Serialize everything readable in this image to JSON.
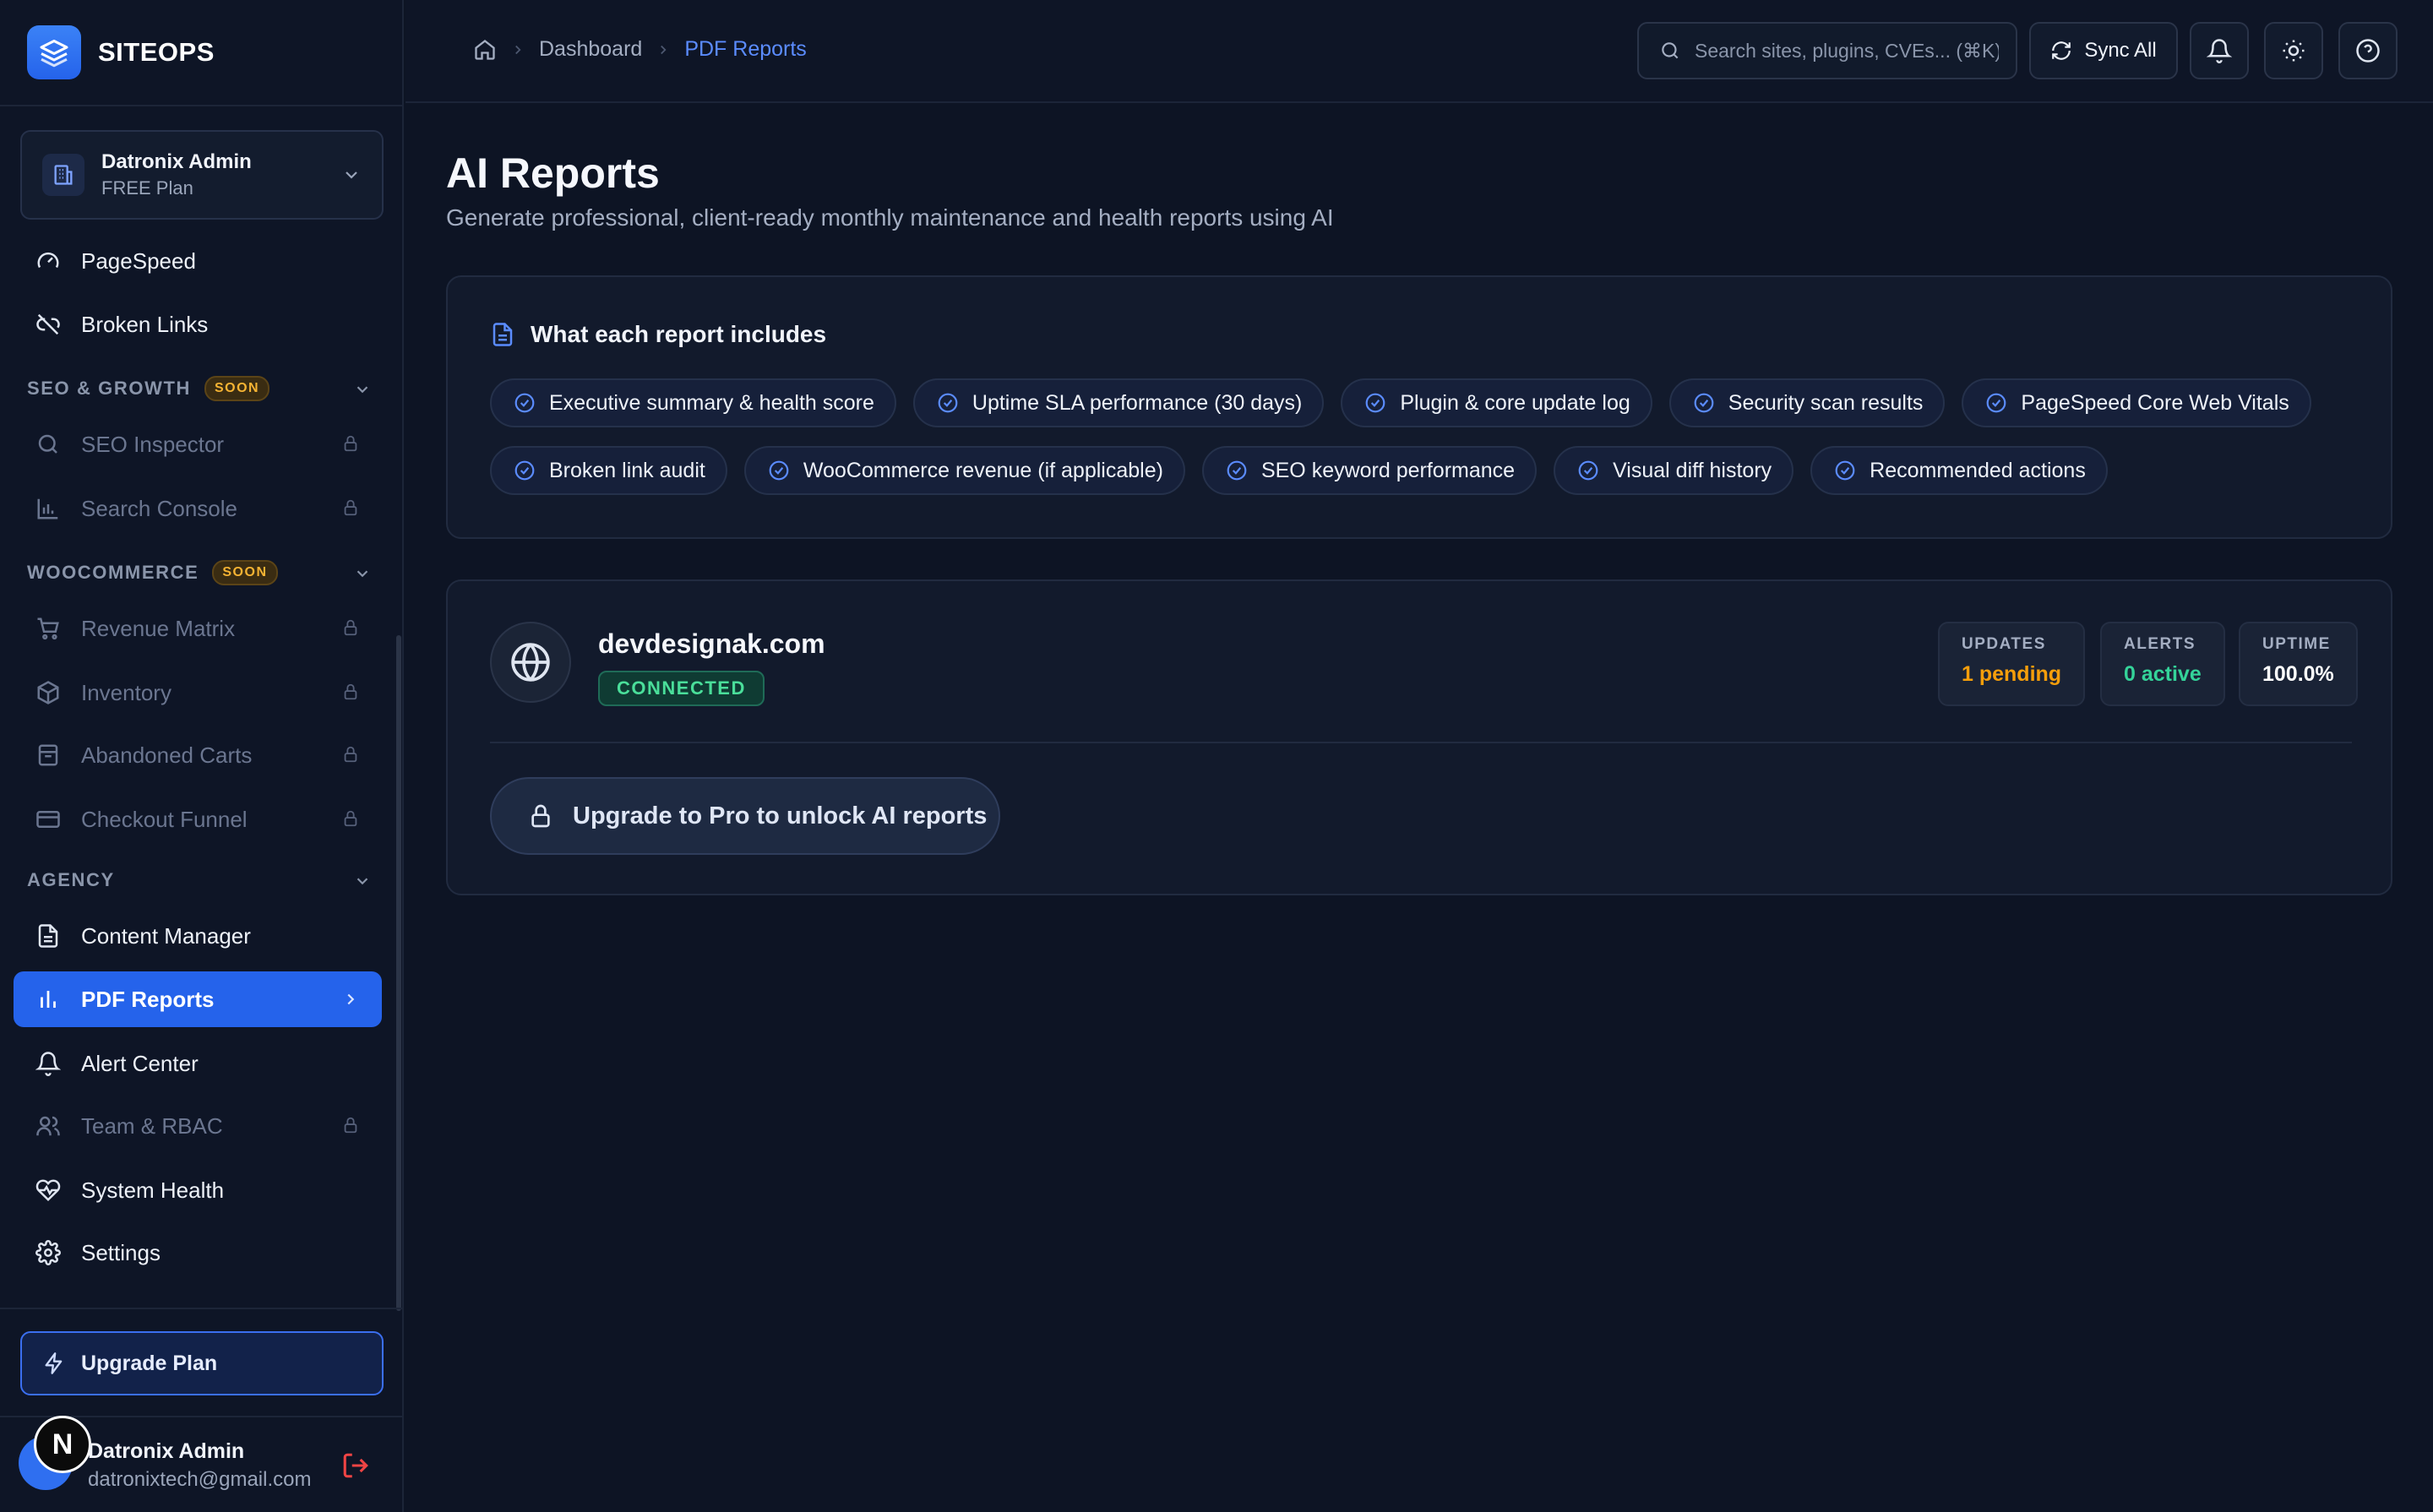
{
  "brand": {
    "name": "SITEOPS"
  },
  "org": {
    "name": "Datronix Admin",
    "plan": "FREE Plan"
  },
  "nav": {
    "top_items": [
      {
        "label": "PageSpeed"
      },
      {
        "label": "Broken Links"
      }
    ],
    "seo": {
      "title": "SEO & GROWTH",
      "badge": "SOON",
      "items": [
        {
          "label": "SEO Inspector"
        },
        {
          "label": "Search Console"
        }
      ]
    },
    "woo": {
      "title": "WOOCOMMERCE",
      "badge": "SOON",
      "items": [
        {
          "label": "Revenue Matrix"
        },
        {
          "label": "Inventory"
        },
        {
          "label": "Abandoned Carts"
        },
        {
          "label": "Checkout Funnel"
        }
      ]
    },
    "agency": {
      "title": "AGENCY",
      "items": [
        {
          "label": "Content Manager"
        },
        {
          "label": "PDF Reports"
        },
        {
          "label": "Alert Center"
        },
        {
          "label": "Team & RBAC"
        },
        {
          "label": "System Health"
        },
        {
          "label": "Settings"
        }
      ]
    }
  },
  "upgrade_plan": {
    "label": "Upgrade Plan"
  },
  "user": {
    "initial": "N",
    "name": "Datronix Admin",
    "email": "datronixtech@gmail.com"
  },
  "header": {
    "breadcrumb": [
      "Dashboard",
      "PDF Reports"
    ],
    "search_placeholder": "Search sites, plugins, CVEs... (⌘K)",
    "sync_label": "Sync All"
  },
  "page": {
    "title": "AI Reports",
    "subtitle": "Generate professional, client-ready monthly maintenance and health reports using AI"
  },
  "includes": {
    "title": "What each report includes",
    "row1": [
      "Executive summary & health score",
      "Uptime SLA performance (30 days)",
      "Plugin & core update log",
      "Security scan results",
      "PageSpeed Core Web Vitals"
    ],
    "row2": [
      "Broken link audit",
      "WooCommerce revenue (if applicable)",
      "SEO keyword performance",
      "Visual diff history",
      "Recommended actions"
    ]
  },
  "site": {
    "domain": "devdesignak.com",
    "status": "CONNECTED",
    "stats": [
      {
        "label": "UPDATES",
        "value": "1 pending",
        "color": "#f59e0b"
      },
      {
        "label": "ALERTS",
        "value": "0 active",
        "color": "#34d399"
      },
      {
        "label": "UPTIME",
        "value": "100.0%",
        "color": "#ffffff"
      }
    ],
    "unlock_label": "Upgrade to Pro to unlock AI reports"
  },
  "colors": {
    "accent": "#2563eb",
    "link": "#5b8cff",
    "success": "#4ade9a",
    "warning": "#f59e0b",
    "danger": "#ef4444"
  }
}
